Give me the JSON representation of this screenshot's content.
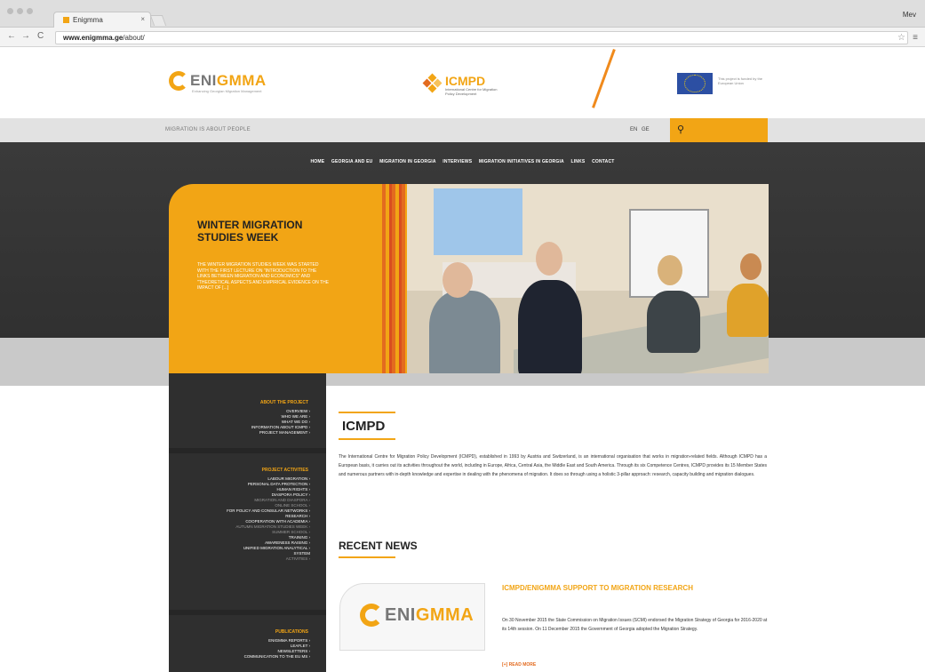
{
  "browser": {
    "tab_title": "Enigmma",
    "tab_close": "×",
    "url_host": "www.enigmma.ge",
    "url_path": "/about/",
    "user_label": "Mev",
    "back": "←",
    "forward": "→",
    "reload": "C",
    "menu": "≡",
    "star": "☆"
  },
  "header": {
    "logo_text_left": "ENI",
    "logo_text_right": "GMMA",
    "logo_tagline": "Enhancing Georgian Migration Management",
    "icmpd_name": "ICMPD",
    "icmpd_sub": "International Centre for Migration Policy Development",
    "eu_text": "This project is funded by the European Union"
  },
  "topbar": {
    "tagline": "MIGRATION IS ABOUT PEOPLE",
    "lang_en": "EN",
    "lang_ge": "GE",
    "search_icon": "🔍"
  },
  "nav": [
    "HOME",
    "GEORGIA AND EU",
    "MIGRATION IN GEORGIA",
    "INTERVIEWS",
    "MIGRATION INITIATIVES IN GEORGIA",
    "LINKS",
    "CONTACT"
  ],
  "hero": {
    "title": "WINTER MIGRATION STUDIES WEEK",
    "description": "THE WINTER MIGRATION STUDIES WEEK WAS STARTED WITH THE FIRST LECTURE ON \"INTRODUCTION TO THE LINKS BETWEEN MIGRATION AND ECONOMICS\" AND \"THEORETICAL ASPECTS AND EMPIRICAL EVIDENCE ON THE IMPACT OF [...]"
  },
  "sidebar": {
    "about_heading": "ABOUT THE PROJECT",
    "about_items": [
      "OVERVIEW",
      "WHO WE ARE",
      "WHAT WE DO",
      "INFORMATION ABOUT ICMPD",
      "PROJECT MANAGEMENT"
    ],
    "activities_heading": "PROJECT ACTIVITIES",
    "activities_items": [
      "LABOUR MIGRATION",
      "PERSONAL DATA PROTECTION",
      "HUMAN RIGHTS",
      "DIASPORA POLICY",
      "MIGRATION AND DIASPORA",
      "ONLINE SCHOOL",
      "FOR POLICY AND CONSULAR NETWORKS",
      "RESEARCH",
      "COOPERATION WITH ACADEMIA",
      "AUTUMN MIGRATION STUDIES WEEK",
      "SUMMER SCHOOL",
      "TRAINING",
      "AWARENESS RAISING",
      "UNIFIED MIGRATION ANALYTICAL",
      "SYSTEM",
      "ACTIVITIES"
    ],
    "publications_heading": "PUBLICATIONS",
    "publications_items": [
      "ENIGMMA REPORTS",
      "LEAFLET",
      "NEWSLETTERS",
      "COMMUNICATION TO THE EU MS"
    ]
  },
  "content": {
    "heading": "ICMPD",
    "paragraph": "The International Centre for Migration Policy Development (ICMPD), established in 1993 by Austria and Switzerland, is an international organisation that works in migration-related fields. Although ICMPD has a European basis, it carries out its activities throughout the world, including in Europe, Africa, Central Asia, the Middle East and South America. Through its six Competence Centres, ICMPD provides its 15 Member States and numerous partners with in-depth knowledge and expertise in dealing with the phenomena of migration. It does so through using a holistic 3-pillar approach: research, capacity building and migration dialogues.",
    "recent_news_heading": "RECENT NEWS",
    "news_title": "ICMPD/ENIGMMA SUPPORT TO MIGRATION RESEARCH",
    "news_body": "On 30 November 2015 the State Commission on Migration Issues (SCMI) endorsed the Migration Strategy of Georgia for 2016-2020 at its 14th session. On 11 December 2015 the Government of Georgia adopted the Migration Strategy.",
    "read_more": "[+] READ MORE"
  }
}
